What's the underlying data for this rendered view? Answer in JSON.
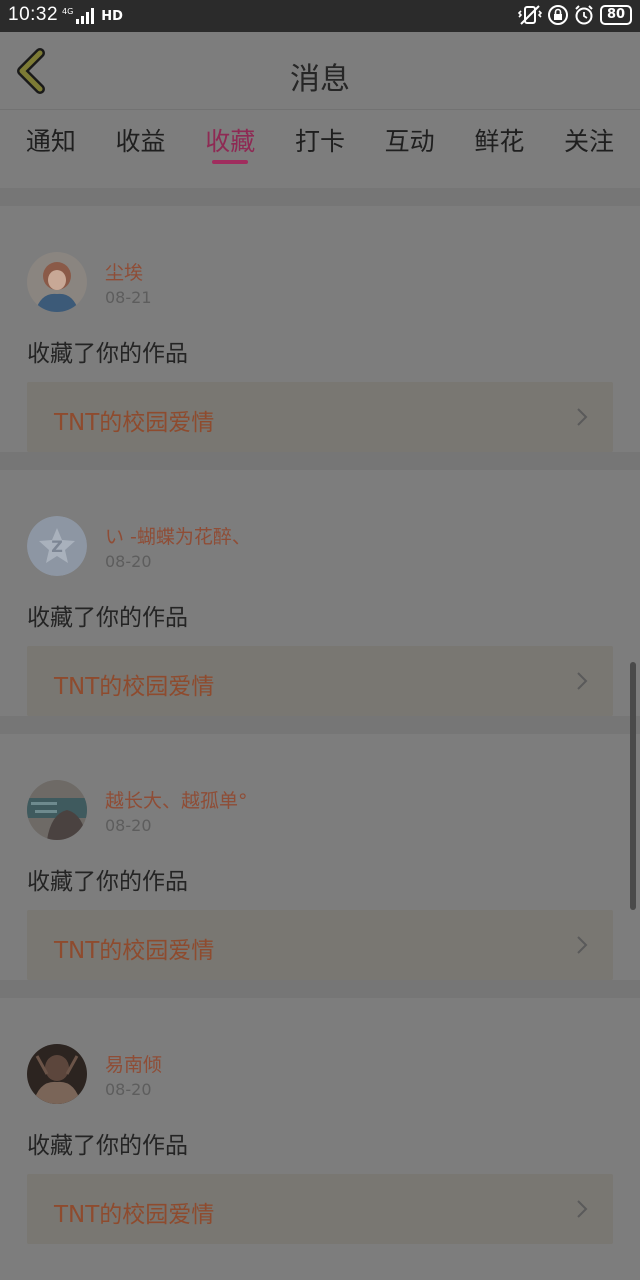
{
  "status_bar": {
    "time": "10:32",
    "network_label": "4G",
    "hd_label": "HD",
    "battery": "80",
    "icons": [
      "signal-icon",
      "vibrate-off-icon",
      "lock-icon",
      "alarm-icon",
      "battery-icon"
    ]
  },
  "header": {
    "title": "消息",
    "back_icon": "chevron-left-icon"
  },
  "tabs": [
    {
      "label": "通知",
      "active": false
    },
    {
      "label": "收益",
      "active": false
    },
    {
      "label": "收藏",
      "active": true
    },
    {
      "label": "打卡",
      "active": false
    },
    {
      "label": "互动",
      "active": false
    },
    {
      "label": "鲜花",
      "active": false
    },
    {
      "label": "关注",
      "active": false
    }
  ],
  "colors": {
    "active_tab": "#a02d5e",
    "name_text": "#8f4d36",
    "work_title": "#8e4b2e"
  },
  "items": [
    {
      "name": "尘埃",
      "date": "08-21",
      "action": "收藏了你的作品",
      "work_title": "TNT的校园爱情"
    },
    {
      "name": "い -蝴蝶为花醉、",
      "date": "08-20",
      "action": "收藏了你的作品",
      "work_title": "TNT的校园爱情"
    },
    {
      "name": "越长大、越孤单°",
      "date": "08-20",
      "action": "收藏了你的作品",
      "work_title": "TNT的校园爱情"
    },
    {
      "name": "易南倾",
      "date": "08-20",
      "action": "收藏了你的作品",
      "work_title": "TNT的校园爱情"
    }
  ]
}
